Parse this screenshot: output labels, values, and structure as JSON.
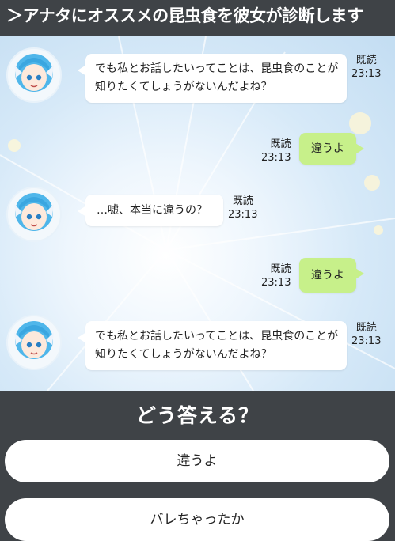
{
  "header": {
    "title": "＞アナタにオススメの昆虫食を彼女が診断します"
  },
  "messages": [
    {
      "side": "left",
      "text": "でも私とお話したいってことは、昆虫食のことが知りたくてしょうがないんだよね？",
      "read": "既読",
      "time": "23:13"
    },
    {
      "side": "right",
      "text": "違うよ",
      "read": "既読",
      "time": "23:13"
    },
    {
      "side": "left",
      "text": "…嘘、本当に違うの？",
      "read": "既読",
      "time": "23:13"
    },
    {
      "side": "right",
      "text": "違うよ",
      "read": "既読",
      "time": "23:13"
    },
    {
      "side": "left",
      "text": "でも私とお話したいってことは、昆虫食のことが知りたくてしょうがないんだよね？",
      "read": "既読",
      "time": "23:13"
    }
  ],
  "prompt": {
    "question": "どう答える？"
  },
  "options": [
    {
      "label": "違うよ"
    },
    {
      "label": "バレちゃったか"
    }
  ],
  "colors": {
    "header_bg": "#3f4347",
    "reply_bubble": "#c7f08a",
    "bubble": "#ffffff"
  }
}
